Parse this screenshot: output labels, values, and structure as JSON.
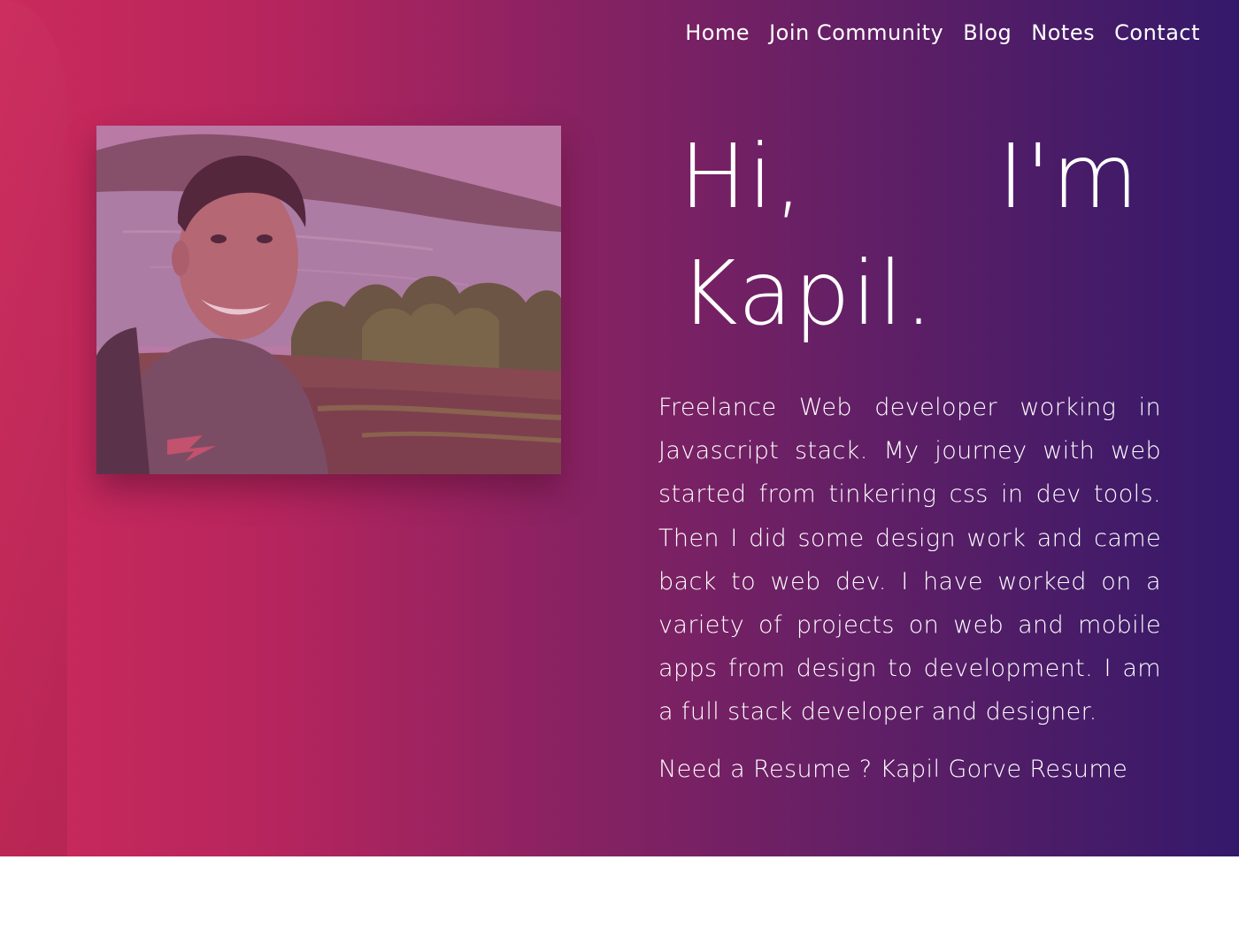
{
  "nav": {
    "items": [
      {
        "label": "Home"
      },
      {
        "label": "Join Community"
      },
      {
        "label": "Blog"
      },
      {
        "label": "Notes"
      },
      {
        "label": "Contact"
      }
    ]
  },
  "hero": {
    "greeting_word1": "Hi,",
    "greeting_word2": "I'm",
    "greeting_name": "Kapil.",
    "bio": "Freelance Web developer working in Javascript stack. My journey with web started from tinkering css in dev tools. Then I did some design work and came back to web dev. I have worked on a variety of projects on web and mobile apps from design to development. I am a full stack developer and designer.",
    "resume_prompt": "Need a Resume ?",
    "resume_link": "Kapil Gorve Resume",
    "photo_icon": "profile-photo"
  },
  "colors": {
    "gradient_start": "#cb2a5c",
    "gradient_end": "#34196a",
    "text": "#ffffff"
  }
}
